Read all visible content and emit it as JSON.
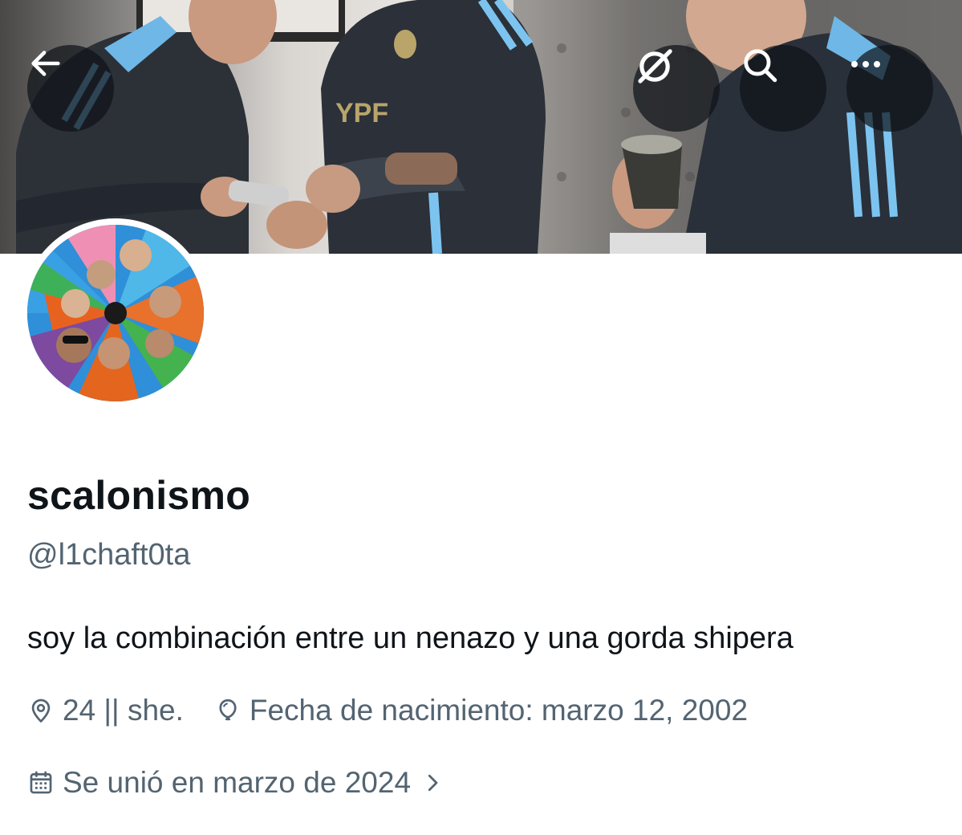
{
  "header": {
    "back_icon": "arrow-left-icon",
    "actions": [
      {
        "icon": "grok-icon"
      },
      {
        "icon": "search-icon"
      },
      {
        "icon": "more-horizontal-icon"
      }
    ],
    "banner_text": "YPF"
  },
  "profile": {
    "display_name": "scalonismo",
    "handle": "@l1chaft0ta",
    "bio": "soy la combinación entre un nenazo y una gorda shipera",
    "location": "24 || she.",
    "birthday": "Fecha de nacimiento: marzo 12, 2002",
    "joined": "Se unió en marzo de 2024"
  },
  "colors": {
    "text_primary": "#0f1419",
    "text_secondary": "#536471",
    "overlay_button": "#0f1419"
  }
}
